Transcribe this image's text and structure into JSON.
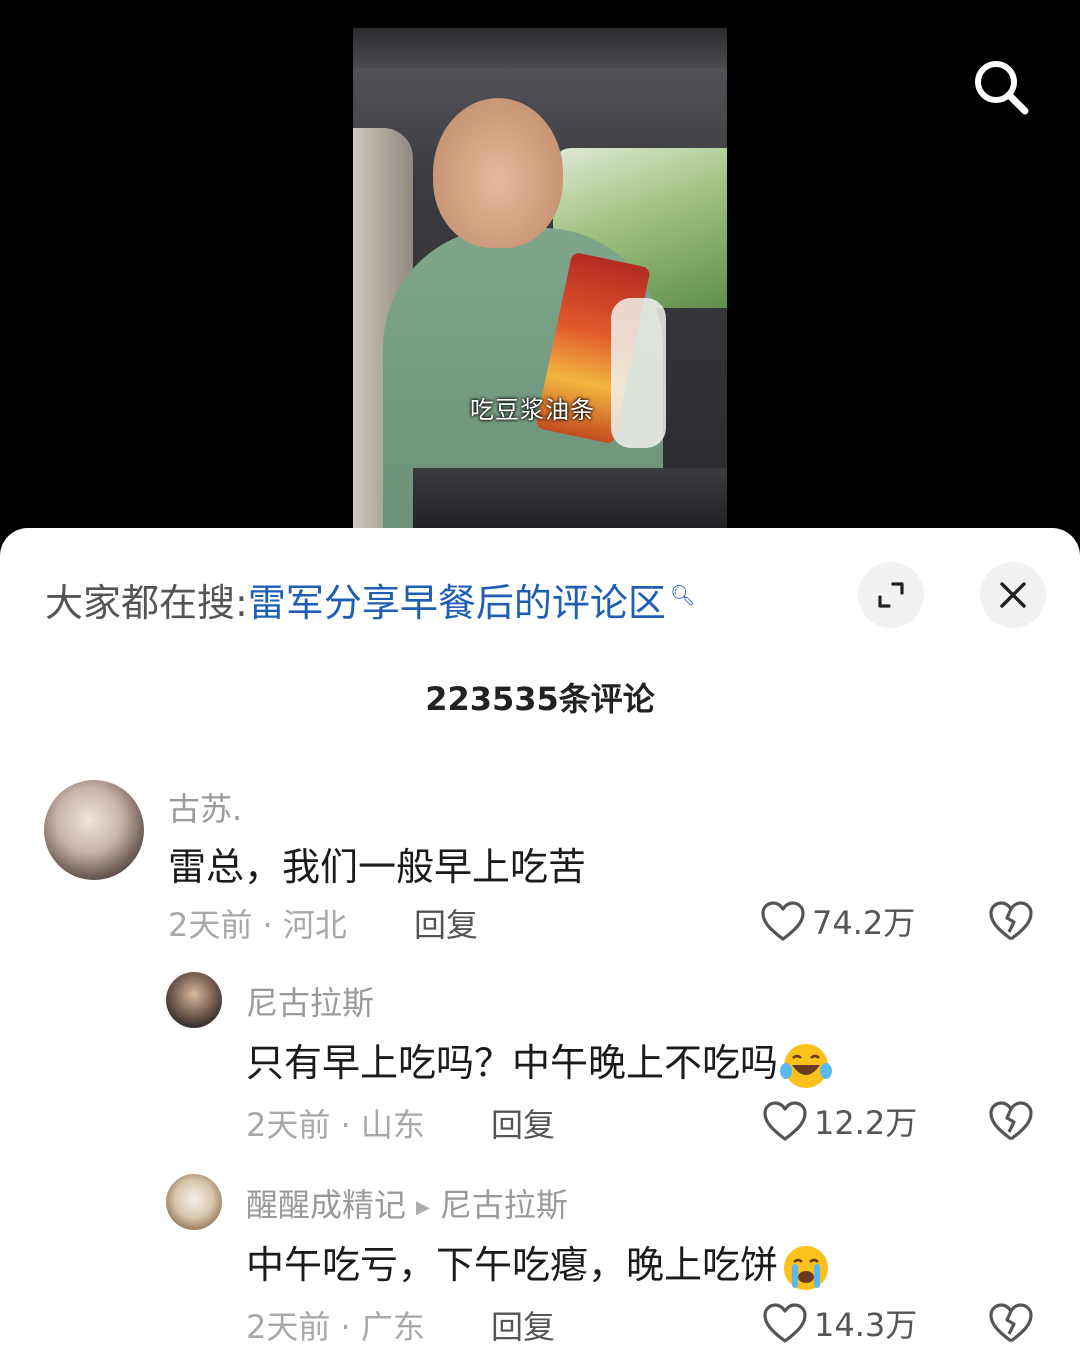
{
  "video": {
    "caption": "吃豆浆油条"
  },
  "panel": {
    "trend_prefix": "大家都在搜:",
    "trend_query": "雷军分享早餐后的评论区",
    "comment_count": "223535条评论"
  },
  "comments": [
    {
      "user": "古苏.",
      "text": "雷总，我们一般早上吃苦",
      "time": "2天前",
      "location": "河北",
      "reply_label": "回复",
      "likes": "74.2万"
    },
    {
      "user": "尼古拉斯",
      "text": "只有早上吃吗？中午晚上不吃吗",
      "emoji": "laughing-crying-emoji",
      "time": "2天前",
      "location": "山东",
      "reply_label": "回复",
      "likes": "12.2万"
    },
    {
      "user": "醒醒成精记",
      "reply_to": "尼古拉斯",
      "text": "中午吃亏，下午吃瘪，晚上吃饼",
      "emoji": "loudly-crying-emoji",
      "time": "2天前",
      "location": "广东",
      "reply_label": "回复",
      "likes": "14.3万"
    }
  ],
  "separator": "·",
  "colors": {
    "accent_link": "#1e5fb5",
    "panel_bg": "#ffffff",
    "video_bg": "#000000"
  }
}
